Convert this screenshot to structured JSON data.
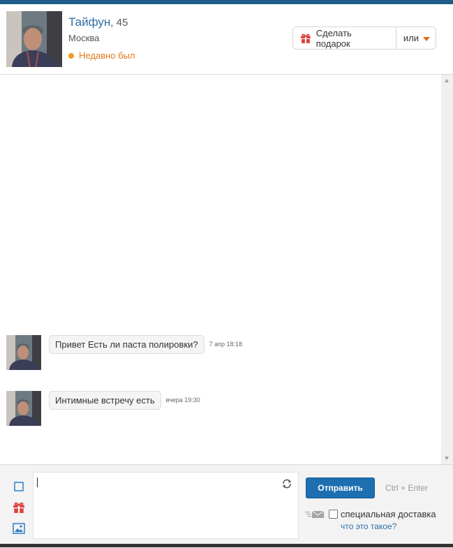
{
  "profile": {
    "name": "Тайфун",
    "age_suffix": ", 45",
    "city": "Москва",
    "status": "Недавно был"
  },
  "actions": {
    "gift_label": "Сделать подарок",
    "or_label": "или"
  },
  "messages": [
    {
      "text": "Привет Есть ли паста полировки?",
      "time": "7 апр 18:18"
    },
    {
      "text": "Интимные встречу есть",
      "time": "вчера 19:30"
    }
  ],
  "composer": {
    "send_label": "Отправить",
    "hint": "Ctrl + Enter",
    "special_delivery": "специальная доставка",
    "what_is_it": "что это такое?"
  },
  "icons": {
    "gift": "gift-icon",
    "square": "square-icon",
    "image": "image-icon",
    "refresh": "refresh-icon",
    "mail": "mail-icon"
  },
  "colors": {
    "accent": "#2f6ea5",
    "status": "#e07a1a",
    "send": "#1e6fb1"
  }
}
